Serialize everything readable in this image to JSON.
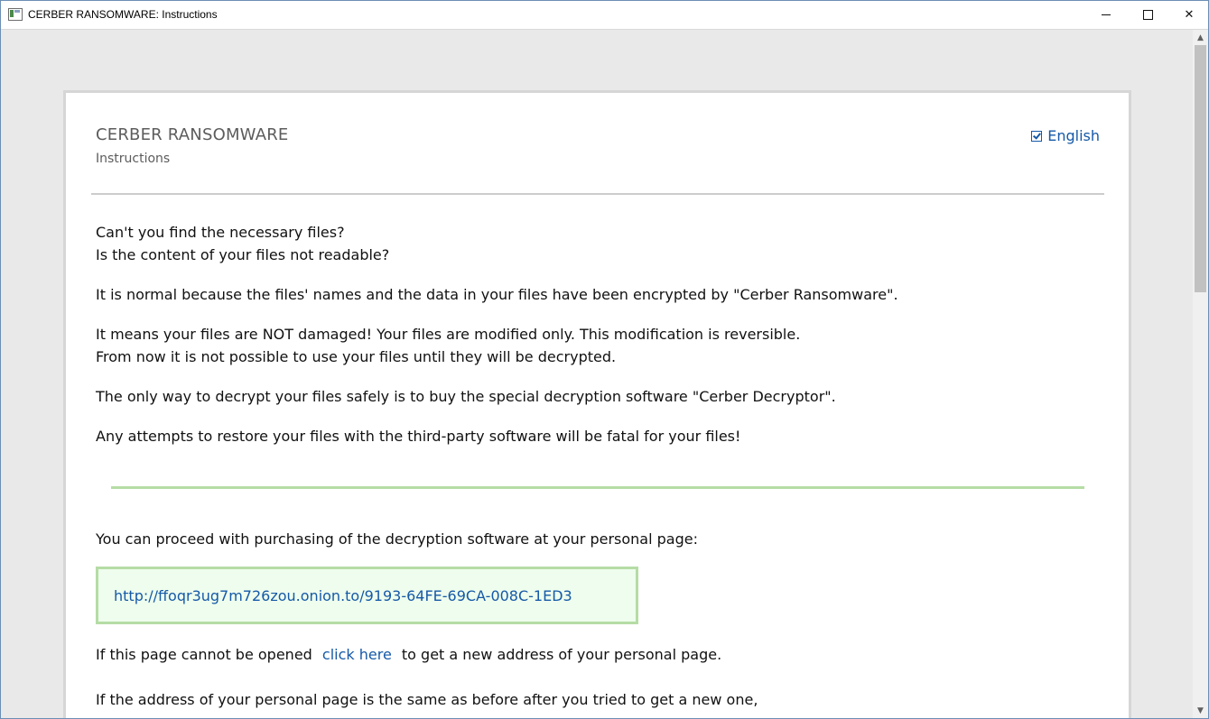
{
  "window": {
    "title": "CERBER RANSOMWARE: Instructions",
    "controls": {
      "minimize": "minimize",
      "maximize": "maximize",
      "close": "✕"
    }
  },
  "header": {
    "title": "CERBER RANSOMWARE",
    "subtitle": "Instructions",
    "language": "English"
  },
  "content": {
    "p1_line1": "Can't you find the necessary files?",
    "p1_line2": "Is the content of your files not readable?",
    "p2": "It is normal because the files' names and the data in your files have been encrypted by \"Cerber Ransomware\".",
    "p3_line1": "It means your files are NOT damaged! Your files are modified only. This modification is reversible.",
    "p3_line2": "From now it is not possible to use your files until they will be decrypted.",
    "p4": "The only way to decrypt your files safely is to buy the special decryption software \"Cerber Decryptor\".",
    "p5": "Any attempts to restore your files with the third-party software will be fatal for your files!",
    "p6": "You can proceed with purchasing of the decryption software at your personal page:",
    "personal_url": "http://ffoqr3ug7m726zou.onion.to/9193-64FE-69CA-008C-1ED3",
    "p7_before": "If this page cannot be opened",
    "p7_link": "click here",
    "p7_after": "to get a new address of your personal page.",
    "p8": "If the address of your personal page is the same as before after you tried to get a new one,"
  },
  "colors": {
    "link": "#1559a8",
    "green_border": "#b5dca5",
    "green_fill": "#eefded"
  }
}
